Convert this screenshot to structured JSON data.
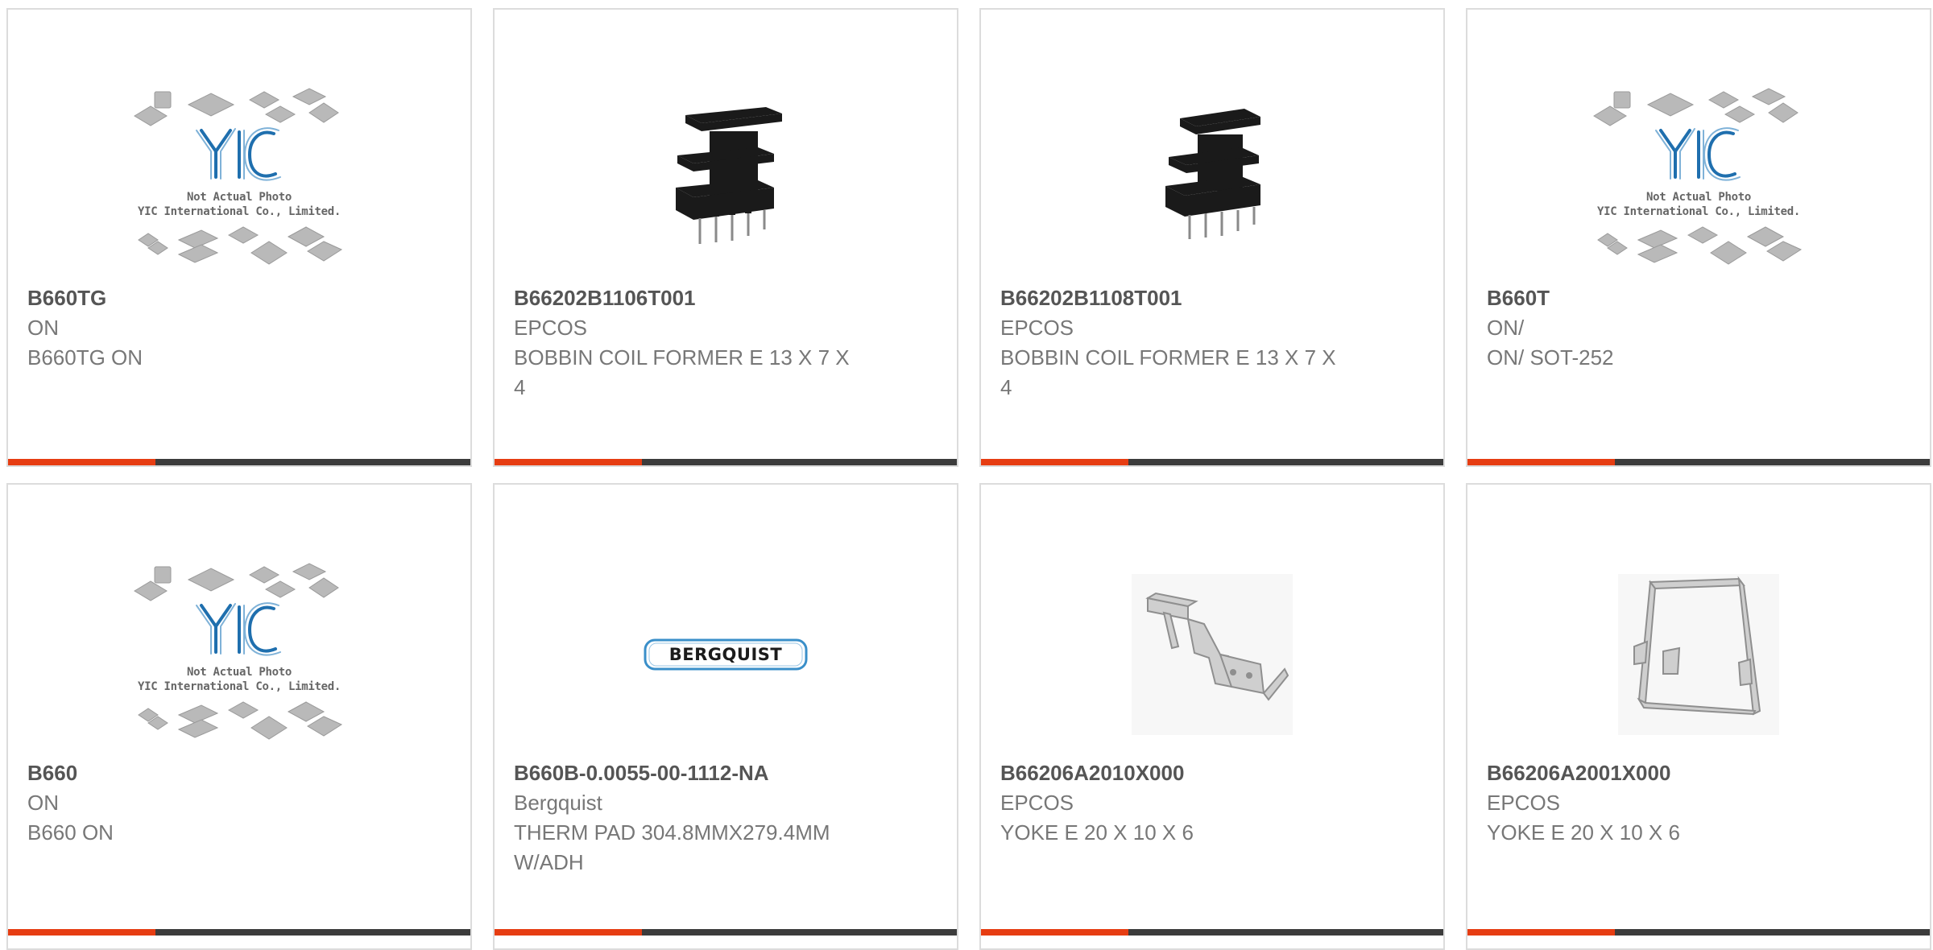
{
  "products": [
    {
      "part": "B660TG",
      "brand": "ON",
      "desc": "B660TG ON",
      "image": "yic-placeholder",
      "placeholder_caption": [
        "Not Actual Photo",
        "YIC International Co., Limited."
      ]
    },
    {
      "part": "B66202B1106T001",
      "brand": "EPCOS",
      "desc": "BOBBIN COIL FORMER E 13 X 7 X 4",
      "image": "bobbin-coil-former"
    },
    {
      "part": "B66202B1108T001",
      "brand": "EPCOS",
      "desc": "BOBBIN COIL FORMER E 13 X 7 X 4",
      "image": "bobbin-coil-former"
    },
    {
      "part": "B660T",
      "brand": "ON/",
      "desc": "ON/ SOT-252",
      "image": "yic-placeholder",
      "placeholder_caption": [
        "Not Actual Photo",
        "YIC International Co., Limited."
      ]
    },
    {
      "part": "B660",
      "brand": "ON",
      "desc": "B660 ON",
      "image": "yic-placeholder",
      "placeholder_caption": [
        "Not Actual Photo",
        "YIC International Co., Limited."
      ]
    },
    {
      "part": "B660B-0.0055-00-1112-NA",
      "brand": "Bergquist",
      "desc": "THERM PAD 304.8MMX279.4MM W/ADH",
      "image": "bergquist-logo",
      "logo_text": "BERGQUIST"
    },
    {
      "part": "B66206A2010X000",
      "brand": "EPCOS",
      "desc": "YOKE E 20 X 10 X 6",
      "image": "metal-yoke-clip"
    },
    {
      "part": "B66206A2001X000",
      "brand": "EPCOS",
      "desc": "YOKE E 20 X 10 X 6",
      "image": "metal-yoke-clip-upright"
    }
  ],
  "colors": {
    "accent": "#e63d12",
    "bar": "#3c3c3c",
    "border": "#dcdcdc",
    "text": "#777777",
    "part_text": "#555555",
    "yic_blue": "#1f6fae"
  }
}
